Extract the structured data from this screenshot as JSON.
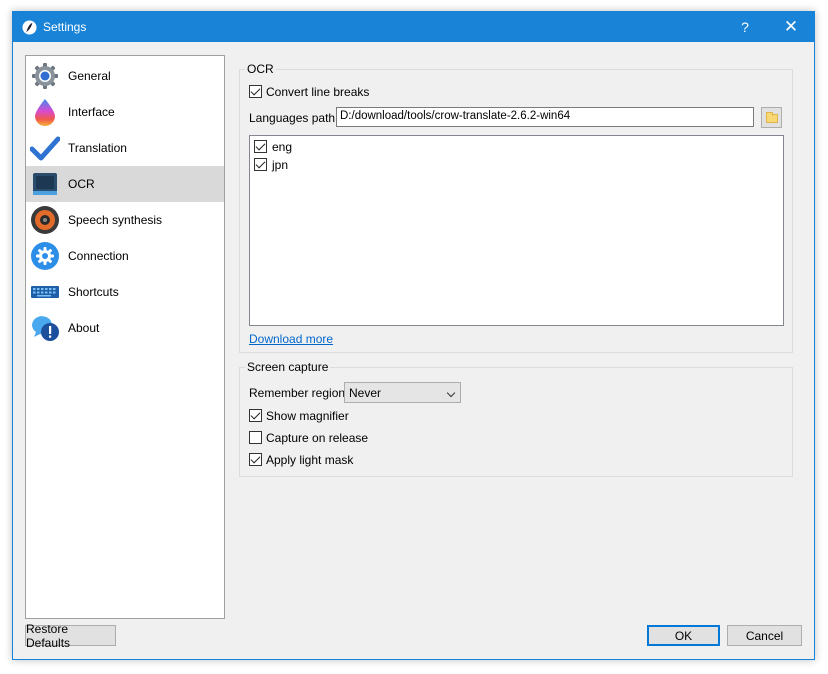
{
  "window": {
    "title": "Settings",
    "help_glyph": "?",
    "close_glyph": "✕"
  },
  "sidebar": {
    "items": [
      {
        "label": "General",
        "icon": "gear-icon"
      },
      {
        "label": "Interface",
        "icon": "paint-drop-icon"
      },
      {
        "label": "Translation",
        "icon": "checkmark-icon"
      },
      {
        "label": "OCR",
        "icon": "scanner-icon",
        "selected": true
      },
      {
        "label": "Speech synthesis",
        "icon": "speaker-icon"
      },
      {
        "label": "Connection",
        "icon": "connection-gear-icon"
      },
      {
        "label": "Shortcuts",
        "icon": "keyboard-icon"
      },
      {
        "label": "About",
        "icon": "info-chat-icon"
      }
    ]
  },
  "ocr": {
    "group_title": "OCR",
    "convert_line_breaks": {
      "label": "Convert line breaks",
      "checked": true
    },
    "languages_path_label": "Languages path:",
    "languages_path_value": "D:/download/tools/crow-translate-2.6.2-win64",
    "languages": [
      {
        "label": "eng",
        "checked": true
      },
      {
        "label": "jpn",
        "checked": true
      }
    ],
    "download_more": "Download more"
  },
  "screen_capture": {
    "group_title": "Screen capture",
    "remember_region_label": "Remember region:",
    "remember_region_value": "Never",
    "show_magnifier": {
      "label": "Show magnifier",
      "checked": true
    },
    "capture_on_release": {
      "label": "Capture on release",
      "checked": false
    },
    "apply_light_mask": {
      "label": "Apply light mask",
      "checked": true
    }
  },
  "footer": {
    "restore_defaults": "Restore Defaults",
    "ok": "OK",
    "cancel": "Cancel"
  },
  "colors": {
    "accent": "#1883d7",
    "selected_row": "#d9d9d9",
    "link": "#0066cc"
  }
}
